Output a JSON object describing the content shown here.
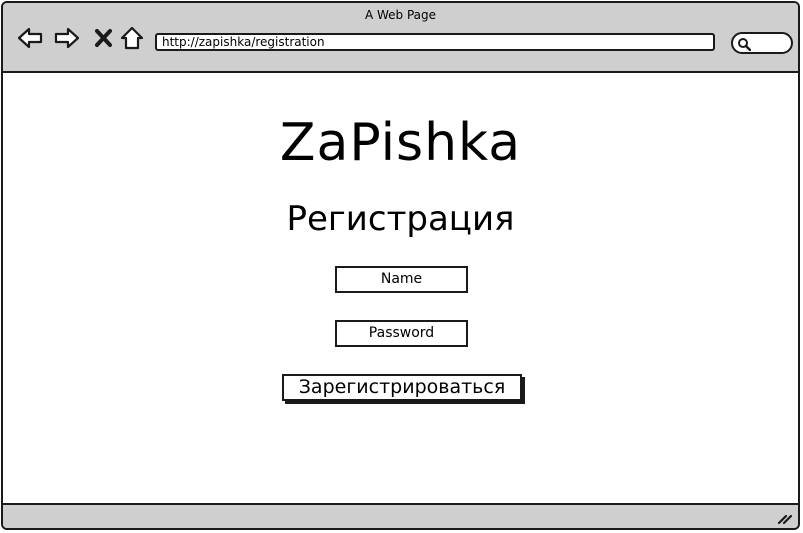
{
  "window": {
    "title": "A Web Page"
  },
  "toolbar": {
    "back_icon": "back-arrow-icon",
    "forward_icon": "forward-arrow-icon",
    "stop_icon": "close-icon",
    "home_icon": "home-icon",
    "search_icon": "search-icon"
  },
  "address_bar": {
    "url": "http://zapishka/registration"
  },
  "page": {
    "app_title": "ZaPishka",
    "heading": "Регистрация",
    "name_field": {
      "value": "Name"
    },
    "password_field": {
      "value": "Password"
    },
    "submit_label": "Зарегистрироваться"
  },
  "status_bar": {
    "grip_icon": "resize-grip-icon"
  }
}
